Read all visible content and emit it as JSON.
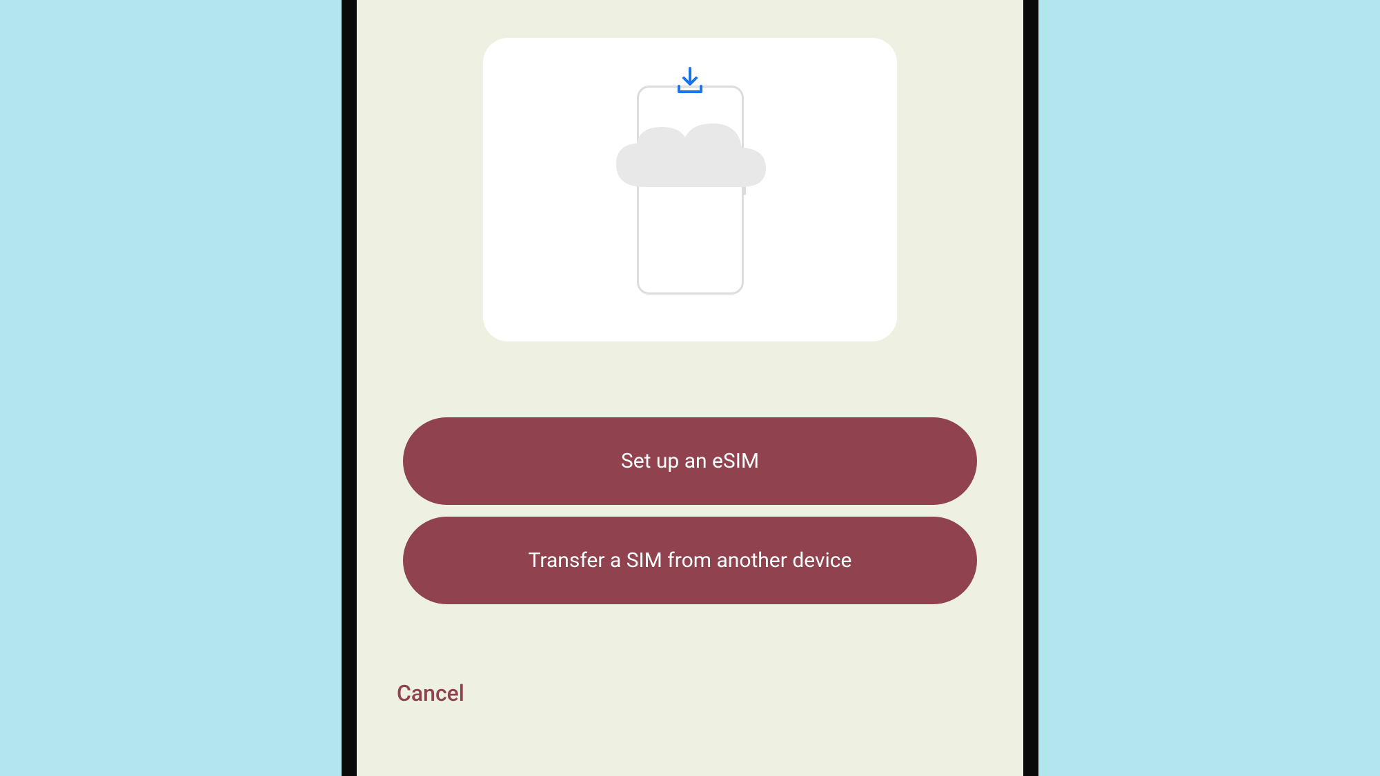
{
  "buttons": {
    "setup_esim": "Set up an eSIM",
    "transfer_sim": "Transfer a SIM from another device",
    "cancel": "Cancel"
  },
  "colors": {
    "background": "#b3e5ee",
    "screen": "#eef1e1",
    "button_primary": "#90434f",
    "button_text": "#ffffff",
    "accent_blue": "#1a73e8"
  }
}
